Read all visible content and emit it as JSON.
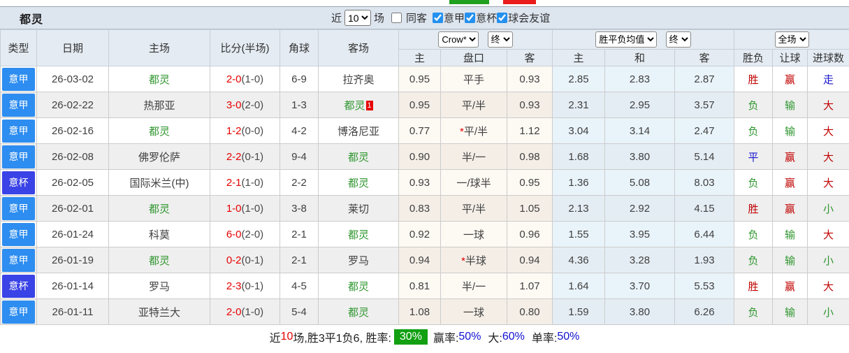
{
  "title_bar": {
    "team": "都灵",
    "recent_prefix": "近",
    "recent_count": "10",
    "recent_suffix": "场",
    "filters": [
      {
        "label": "同客",
        "checked": false
      },
      {
        "label": "意甲",
        "checked": true
      },
      {
        "label": "意杯",
        "checked": true
      },
      {
        "label": "球会友谊",
        "checked": true
      }
    ]
  },
  "table": {
    "main_headers": [
      "类型",
      "日期",
      "主场",
      "比分(半场)",
      "角球",
      "客场"
    ],
    "selects": {
      "bookmaker": "Crow*",
      "bookmaker_time": "终",
      "avg": "胜平负均值",
      "avg_time": "终",
      "scope": "全场"
    },
    "sub_headers": [
      "主",
      "盘口",
      "客",
      "主",
      "和",
      "客",
      "胜负",
      "让球",
      "进球数"
    ],
    "rows": [
      {
        "league": "意甲",
        "league_key": "league",
        "date": "26-03-02",
        "home": "都灵",
        "home_key": "self",
        "score": "2-0",
        "half_score": "(1-0)",
        "corners": "6-9",
        "away": "拉齐奥",
        "away_key": "other",
        "away_red_card": "",
        "handicap_home_odds": "0.95",
        "handicap_star": "",
        "handicap": "平手",
        "handicap_away_odds": "0.93",
        "avg_home": "2.85",
        "avg_draw": "2.83",
        "avg_away": "2.87",
        "result": "胜",
        "result_color": "red",
        "handicap_result": "赢",
        "handicap_result_color": "red",
        "goals_result": "走",
        "goals_result_color": "blue"
      },
      {
        "league": "意甲",
        "league_key": "league",
        "date": "26-02-22",
        "home": "热那亚",
        "home_key": "other",
        "score": "3-0",
        "half_score": "(2-0)",
        "corners": "1-3",
        "away": "都灵",
        "away_key": "self",
        "away_red_card": "1",
        "handicap_home_odds": "0.95",
        "handicap_star": "",
        "handicap": "平/半",
        "handicap_away_odds": "0.93",
        "avg_home": "2.31",
        "avg_draw": "2.95",
        "avg_away": "3.57",
        "result": "负",
        "result_color": "green",
        "handicap_result": "输",
        "handicap_result_color": "green",
        "goals_result": "大",
        "goals_result_color": "red"
      },
      {
        "league": "意甲",
        "league_key": "league",
        "date": "26-02-16",
        "home": "都灵",
        "home_key": "self",
        "score": "1-2",
        "half_score": "(0-0)",
        "corners": "4-2",
        "away": "博洛尼亚",
        "away_key": "other",
        "away_red_card": "",
        "handicap_home_odds": "0.77",
        "handicap_star": "*",
        "handicap": "平/半",
        "handicap_away_odds": "1.12",
        "avg_home": "3.04",
        "avg_draw": "3.14",
        "avg_away": "2.47",
        "result": "负",
        "result_color": "green",
        "handicap_result": "输",
        "handicap_result_color": "green",
        "goals_result": "大",
        "goals_result_color": "red"
      },
      {
        "league": "意甲",
        "league_key": "league",
        "date": "26-02-08",
        "home": "佛罗伦萨",
        "home_key": "other",
        "score": "2-2",
        "half_score": "(0-1)",
        "corners": "9-4",
        "away": "都灵",
        "away_key": "self",
        "away_red_card": "",
        "handicap_home_odds": "0.90",
        "handicap_star": "",
        "handicap": "半/一",
        "handicap_away_odds": "0.98",
        "avg_home": "1.68",
        "avg_draw": "3.80",
        "avg_away": "5.14",
        "result": "平",
        "result_color": "blue",
        "handicap_result": "赢",
        "handicap_result_color": "red",
        "goals_result": "大",
        "goals_result_color": "red"
      },
      {
        "league": "意杯",
        "league_key": "cup",
        "date": "26-02-05",
        "home": "国际米兰(中)",
        "home_key": "other",
        "score": "2-1",
        "half_score": "(1-0)",
        "corners": "2-2",
        "away": "都灵",
        "away_key": "self",
        "away_red_card": "",
        "handicap_home_odds": "0.93",
        "handicap_star": "",
        "handicap": "一/球半",
        "handicap_away_odds": "0.95",
        "avg_home": "1.36",
        "avg_draw": "5.08",
        "avg_away": "8.03",
        "result": "负",
        "result_color": "green",
        "handicap_result": "赢",
        "handicap_result_color": "red",
        "goals_result": "大",
        "goals_result_color": "red"
      },
      {
        "league": "意甲",
        "league_key": "league",
        "date": "26-02-01",
        "home": "都灵",
        "home_key": "self",
        "score": "1-0",
        "half_score": "(1-0)",
        "corners": "3-8",
        "away": "莱切",
        "away_key": "other",
        "away_red_card": "",
        "handicap_home_odds": "0.83",
        "handicap_star": "",
        "handicap": "平/半",
        "handicap_away_odds": "1.05",
        "avg_home": "2.13",
        "avg_draw": "2.92",
        "avg_away": "4.15",
        "result": "胜",
        "result_color": "red",
        "handicap_result": "赢",
        "handicap_result_color": "red",
        "goals_result": "小",
        "goals_result_color": "green"
      },
      {
        "league": "意甲",
        "league_key": "league",
        "date": "26-01-24",
        "home": "科莫",
        "home_key": "other",
        "score": "6-0",
        "half_score": "(2-0)",
        "corners": "2-1",
        "away": "都灵",
        "away_key": "self",
        "away_red_card": "",
        "handicap_home_odds": "0.92",
        "handicap_star": "",
        "handicap": "一球",
        "handicap_away_odds": "0.96",
        "avg_home": "1.55",
        "avg_draw": "3.95",
        "avg_away": "6.44",
        "result": "负",
        "result_color": "green",
        "handicap_result": "输",
        "handicap_result_color": "green",
        "goals_result": "大",
        "goals_result_color": "red"
      },
      {
        "league": "意甲",
        "league_key": "league",
        "date": "26-01-19",
        "home": "都灵",
        "home_key": "self",
        "score": "0-2",
        "half_score": "(0-1)",
        "corners": "2-1",
        "away": "罗马",
        "away_key": "other",
        "away_red_card": "",
        "handicap_home_odds": "0.94",
        "handicap_star": "*",
        "handicap": "半球",
        "handicap_away_odds": "0.94",
        "avg_home": "4.36",
        "avg_draw": "3.28",
        "avg_away": "1.93",
        "result": "负",
        "result_color": "green",
        "handicap_result": "输",
        "handicap_result_color": "green",
        "goals_result": "小",
        "goals_result_color": "green"
      },
      {
        "league": "意杯",
        "league_key": "cup",
        "date": "26-01-14",
        "home": "罗马",
        "home_key": "other",
        "score": "2-3",
        "half_score": "(0-1)",
        "corners": "4-5",
        "away": "都灵",
        "away_key": "self",
        "away_red_card": "",
        "handicap_home_odds": "0.81",
        "handicap_star": "",
        "handicap": "半/一",
        "handicap_away_odds": "1.07",
        "avg_home": "1.64",
        "avg_draw": "3.70",
        "avg_away": "5.53",
        "result": "胜",
        "result_color": "red",
        "handicap_result": "赢",
        "handicap_result_color": "red",
        "goals_result": "大",
        "goals_result_color": "red"
      },
      {
        "league": "意甲",
        "league_key": "league",
        "date": "26-01-11",
        "home": "亚特兰大",
        "home_key": "other",
        "score": "2-0",
        "half_score": "(1-0)",
        "corners": "5-4",
        "away": "都灵",
        "away_key": "self",
        "away_red_card": "",
        "handicap_home_odds": "1.08",
        "handicap_star": "",
        "handicap": "一球",
        "handicap_away_odds": "0.80",
        "avg_home": "1.59",
        "avg_draw": "3.80",
        "avg_away": "6.26",
        "result": "负",
        "result_color": "green",
        "handicap_result": "输",
        "handicap_result_color": "green",
        "goals_result": "小",
        "goals_result_color": "green"
      }
    ]
  },
  "summary": {
    "prefix": "近",
    "recent_count": "10",
    "stats_text": "场,胜3平1负6, 胜率:",
    "win_rate": "30%",
    "handicap_label": "赢率:",
    "handicap_rate": "50%",
    "big_label": "大:",
    "big_rate": "60%",
    "odd_label": "单率:",
    "odd_rate": "50%"
  },
  "colors": {
    "league_badge_blue": "#2d8df0",
    "cup_badge_indigo": "#3a43e6",
    "self_team_green": "#2f962f",
    "score_red": "#e60000",
    "result_red": "#c00000",
    "result_green": "#2f962f",
    "result_blue": "#1616cc",
    "win_rate_badge_green": "#12a012",
    "rate_value_blue": "#0f0fd0",
    "title_bar_bg": "#dde5ef",
    "header_bg": "#e4ebf2"
  }
}
